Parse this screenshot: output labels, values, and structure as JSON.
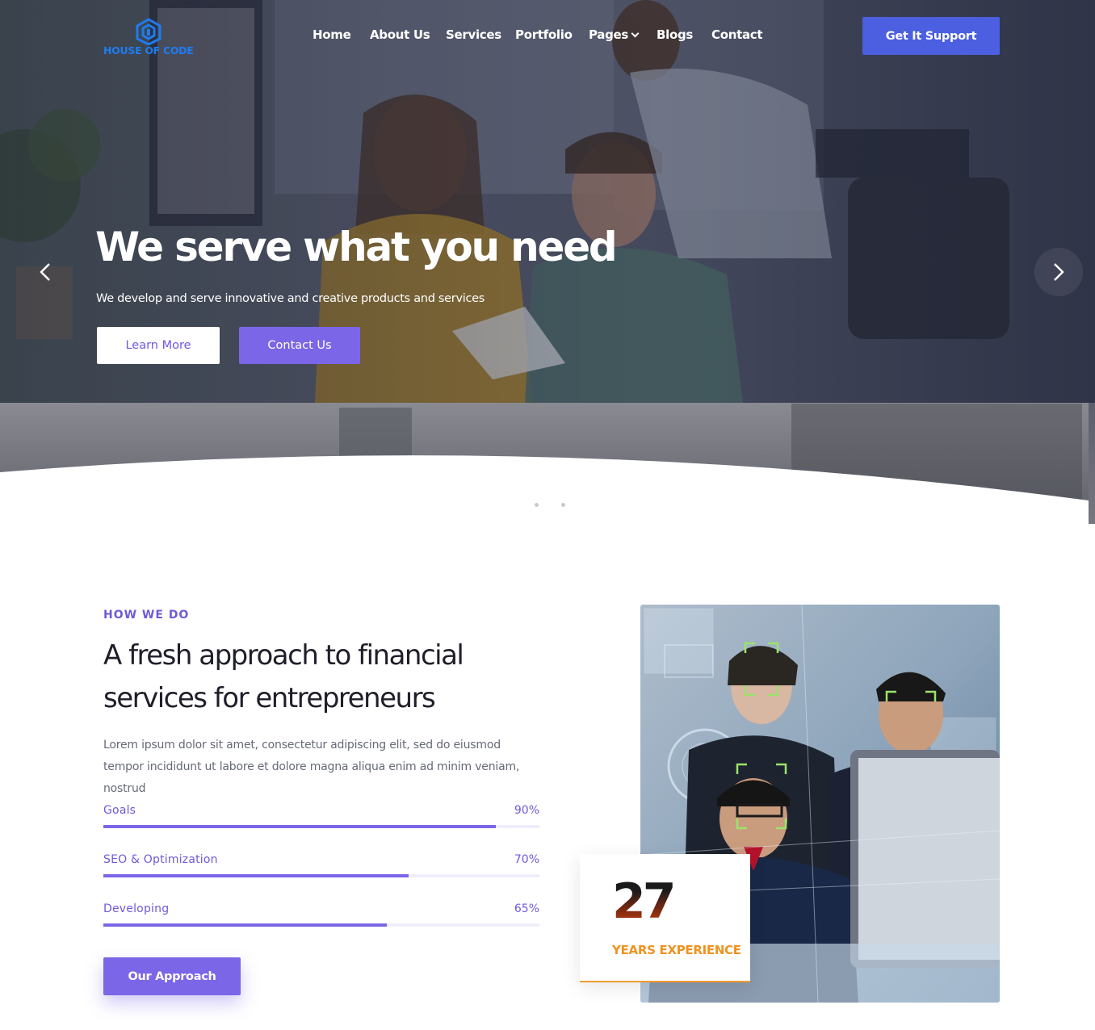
{
  "brand": {
    "name": "HOUSE OF CODE",
    "color": "#1e7cf0"
  },
  "nav": {
    "items": [
      {
        "label": "Home"
      },
      {
        "label": "About Us"
      },
      {
        "label": "Services"
      },
      {
        "label": "Portfolio"
      },
      {
        "label": "Pages",
        "has_dropdown": true
      },
      {
        "label": "Blogs"
      },
      {
        "label": "Contact"
      }
    ],
    "cta_label": "Get It Support"
  },
  "hero": {
    "title": "We serve what you need",
    "subtitle": "We develop and serve innovative and creative products and services",
    "primary_button": "Learn More",
    "secondary_button": "Contact Us",
    "slides_total": 3,
    "active_slide": 2
  },
  "about": {
    "eyebrow": "HOW WE DO",
    "title": "A fresh approach to financial services for entrepreneurs",
    "text": "Lorem ipsum dolor sit amet, consectetur adipiscing elit, sed do eiusmod tempor incididunt ut labore et dolore magna aliqua enim ad minim veniam, nostrud",
    "skills": [
      {
        "label": "Goals",
        "value_text": "90%",
        "value": 0.9
      },
      {
        "label": "SEO & Optimization",
        "value_text": "70%",
        "value": 0.7
      },
      {
        "label": "Developing",
        "value_text": "65%",
        "value": 0.65
      }
    ],
    "button_label": "Our Approach",
    "experience": {
      "number": "27",
      "label": "YEARS EXPERIENCE"
    }
  },
  "colors": {
    "accent": "#7b66e8",
    "cta_blue": "#4b5fe0",
    "experience_orange": "#f0921f"
  }
}
